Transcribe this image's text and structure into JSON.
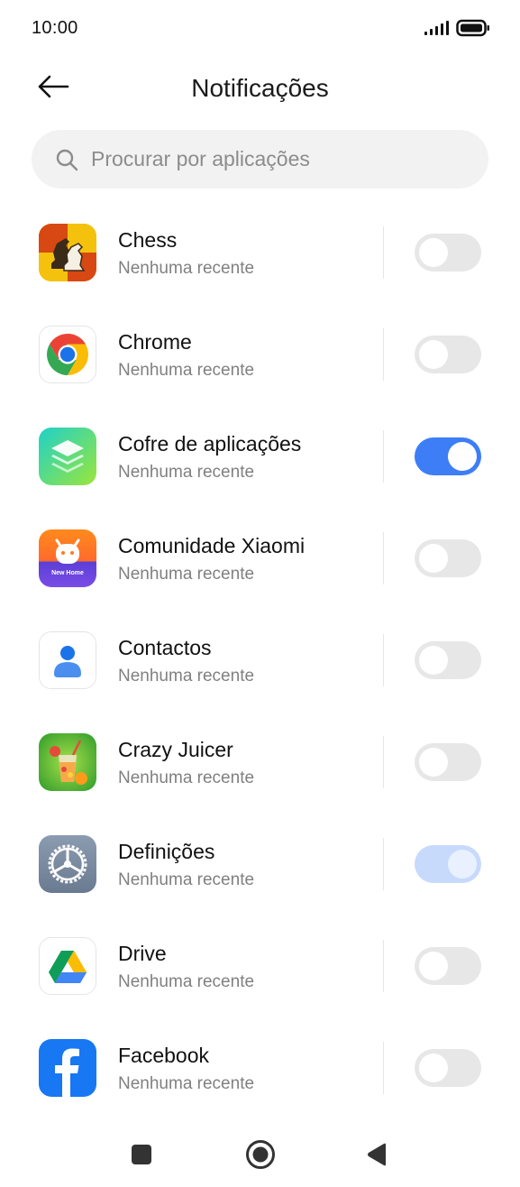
{
  "status_bar": {
    "time": "10:00",
    "icons": [
      "signal-icon",
      "battery-icon"
    ]
  },
  "header": {
    "title": "Notificações",
    "back_icon": "arrow-left-icon"
  },
  "search": {
    "placeholder": "Procurar por aplicações",
    "value": ""
  },
  "apps": [
    {
      "name": "Chess",
      "subtitle": "Nenhuma recente",
      "icon": "chess-app-icon",
      "toggle": "off"
    },
    {
      "name": "Chrome",
      "subtitle": "Nenhuma recente",
      "icon": "chrome-app-icon",
      "toggle": "off"
    },
    {
      "name": "Cofre de aplicações",
      "subtitle": "Nenhuma recente",
      "icon": "app-vault-icon",
      "toggle": "on"
    },
    {
      "name": "Comunidade Xiaomi",
      "subtitle": "Nenhuma recente",
      "icon": "xiaomi-community-icon",
      "icon_text": "New Home",
      "toggle": "off"
    },
    {
      "name": "Contactos",
      "subtitle": "Nenhuma recente",
      "icon": "contacts-app-icon",
      "toggle": "off"
    },
    {
      "name": "Crazy Juicer",
      "subtitle": "Nenhuma recente",
      "icon": "crazy-juicer-icon",
      "toggle": "off"
    },
    {
      "name": "Definições",
      "subtitle": "Nenhuma recente",
      "icon": "settings-app-icon",
      "toggle": "on-disabled"
    },
    {
      "name": "Drive",
      "subtitle": "Nenhuma recente",
      "icon": "drive-app-icon",
      "toggle": "off"
    },
    {
      "name": "Facebook",
      "subtitle": "Nenhuma recente",
      "icon": "facebook-app-icon",
      "toggle": "off"
    }
  ],
  "nav_bar": {
    "buttons": [
      "recents-square-icon",
      "home-circle-icon",
      "back-triangle-icon"
    ]
  },
  "colors": {
    "accent": "#3d7ef7",
    "toggle_off": "#e7e7e7",
    "toggle_disabled_on": "#c7dafc",
    "search_bg": "#f2f2f2",
    "subtitle": "#808080"
  }
}
